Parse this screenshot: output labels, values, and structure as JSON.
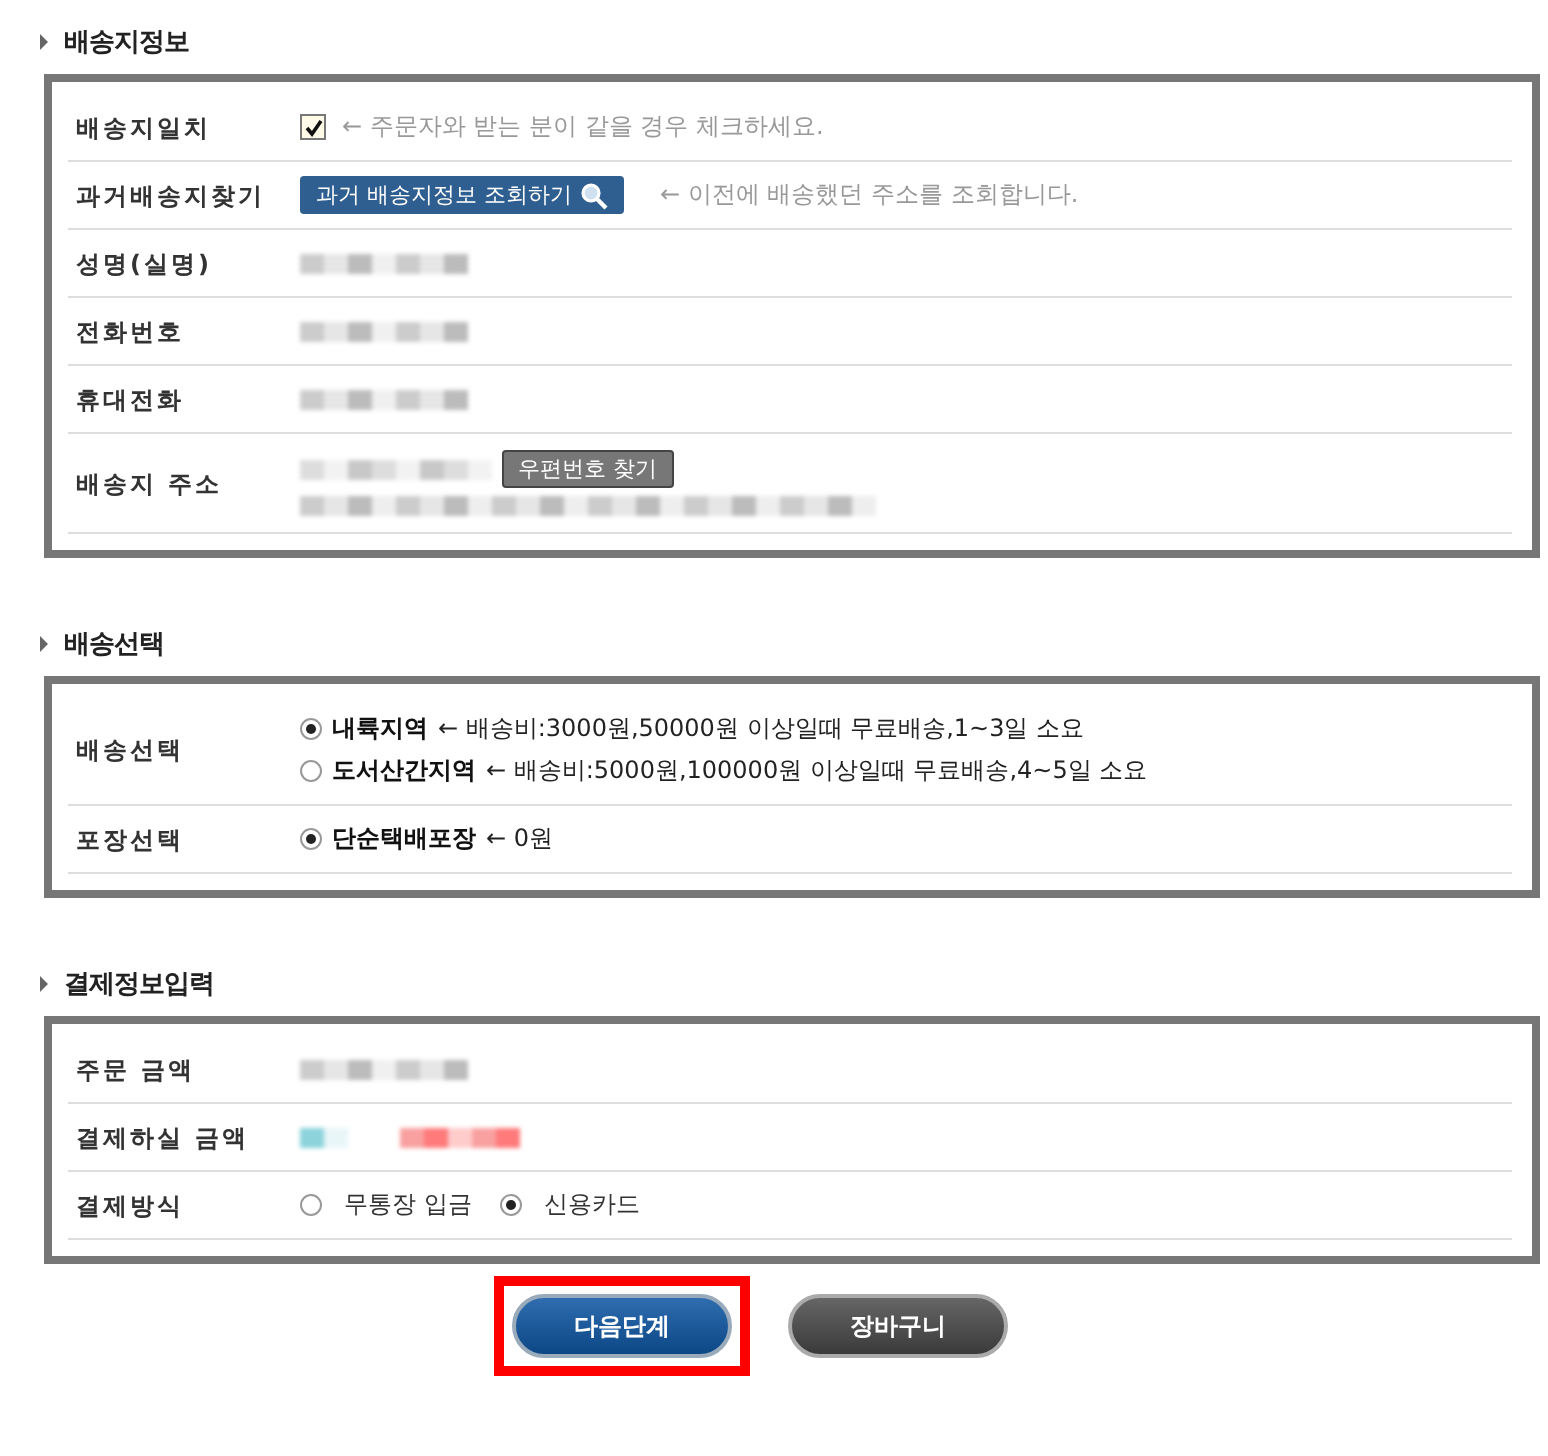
{
  "sections": [
    {
      "title": "배송지정보",
      "rows": [
        {
          "label": "배송지일치",
          "kind": "checkbox",
          "checked": true,
          "note": "← 주문자와 받는 분이 같을 경우 체크하세요."
        },
        {
          "label": "과거배송지찾기",
          "kind": "lookup",
          "button": "과거 배송지정보 조회하기",
          "note": "← 이전에 배송했던 주소를 조회합니다."
        },
        {
          "label": "성명(실명)",
          "kind": "redacted"
        },
        {
          "label": "전화번호",
          "kind": "redacted"
        },
        {
          "label": "휴대전화",
          "kind": "redacted"
        },
        {
          "label": "배송지 주소",
          "kind": "address",
          "button": "우편번호 찾기"
        }
      ]
    },
    {
      "title": "배송선택",
      "rows": [
        {
          "label": "배송선택",
          "kind": "radio",
          "options": [
            {
              "label": "내륙지역",
              "note": "← 배송비:3000원,50000원 이상일때 무료배송,1~3일 소요",
              "selected": true
            },
            {
              "label": "도서산간지역",
              "note": "← 배송비:5000원,100000원 이상일때 무료배송,4~5일 소요",
              "selected": false
            }
          ]
        },
        {
          "label": "포장선택",
          "kind": "radio",
          "options": [
            {
              "label": "단순택배포장",
              "note": "← 0원",
              "selected": true
            }
          ]
        }
      ]
    },
    {
      "title": "결제정보입력",
      "rows": [
        {
          "label": "주문 금액",
          "kind": "redacted"
        },
        {
          "label": "결제하실 금액",
          "kind": "redacted_amount"
        },
        {
          "label": "결제방식",
          "kind": "payment",
          "options": [
            {
              "label": "무통장 입금",
              "selected": false
            },
            {
              "label": "신용카드",
              "selected": true
            }
          ]
        }
      ]
    }
  ],
  "buttons": [
    {
      "label": "다음단계",
      "kind": "primary",
      "highlighted": true
    },
    {
      "label": "장바구니",
      "kind": "secondary",
      "highlighted": false
    }
  ]
}
